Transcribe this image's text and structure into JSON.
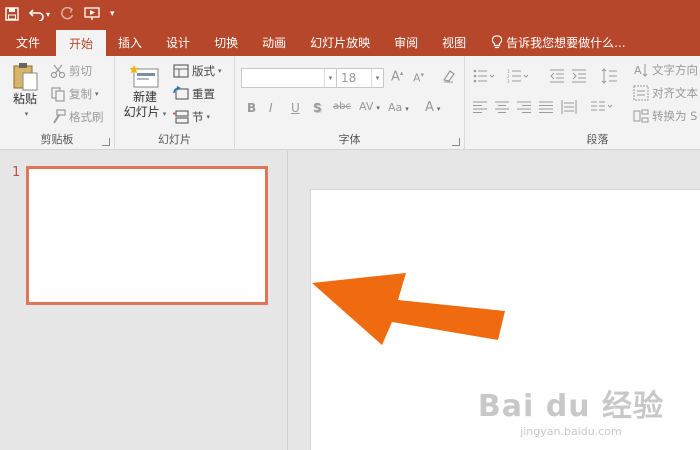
{
  "quick_access": {
    "save_icon": "save-icon",
    "undo_icon": "undo-icon",
    "redo_icon": "redo-icon",
    "present_icon": "present-from-start-icon",
    "customize_icon": "customize-qat-icon"
  },
  "tabs": [
    {
      "label": "文件",
      "active": false
    },
    {
      "label": "开始",
      "active": true
    },
    {
      "label": "插入",
      "active": false
    },
    {
      "label": "设计",
      "active": false
    },
    {
      "label": "切换",
      "active": false
    },
    {
      "label": "动画",
      "active": false
    },
    {
      "label": "幻灯片放映",
      "active": false
    },
    {
      "label": "审阅",
      "active": false
    },
    {
      "label": "视图",
      "active": false
    }
  ],
  "tell_me": "告诉我您想要做什么...",
  "ribbon": {
    "clipboard": {
      "paste": "粘贴",
      "cut": "剪切",
      "copy": "复制",
      "format_painter": "格式刷",
      "label": "剪贴板"
    },
    "slides": {
      "new_slide_line1": "新建",
      "new_slide_line2": "幻灯片",
      "layout": "版式",
      "reset": "重置",
      "section": "节",
      "label": "幻灯片"
    },
    "font": {
      "font_name": "",
      "font_size": "18",
      "label": "字体",
      "bold": "B",
      "italic": "I",
      "underline": "U",
      "shadow": "S",
      "strike": "abc",
      "spacing": "AV",
      "case": "Aa",
      "color": "A"
    },
    "paragraph": {
      "text_direction": "文字方向",
      "align_text": "对齐文本",
      "convert": "转换为 S",
      "label": "段落"
    }
  },
  "slides": [
    {
      "number": "1"
    }
  ],
  "watermark": {
    "logo": "Bai du 经验",
    "url": "jingyan.baidu.com"
  },
  "colors": {
    "accent": "#b7472a",
    "thumb_border": "#e07657",
    "arrow": "#f06a0f"
  }
}
